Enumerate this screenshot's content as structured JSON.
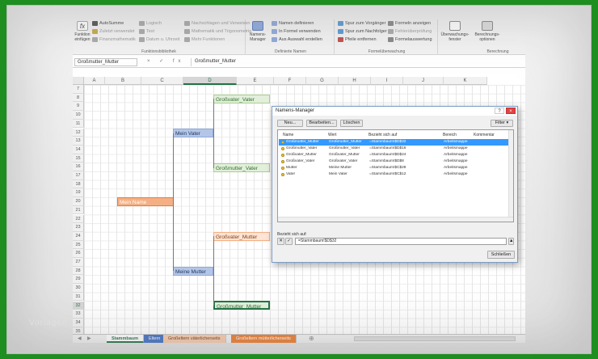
{
  "watermark": "Vorlagen",
  "ribbon": {
    "insert_function": "Funktion einfügen",
    "group1_items": [
      "AutoSumme",
      "Zuletzt verwendet",
      "Finanzmathematik"
    ],
    "group2_items": [
      "Logisch",
      "Text",
      "Datum u. Uhrzeit"
    ],
    "group3_items": [
      "Nachschlagen und Verweisen",
      "Mathematik und Trigonometrie",
      "Mehr Funktionen"
    ],
    "group_label_functions": "Funktionsbibliothek",
    "names_manager": "Namens-Manager",
    "names_items": [
      "Namen definieren",
      "In Formel verwenden",
      "Aus Auswahl erstellen"
    ],
    "group_label_names": "Definierte Namen",
    "audit_items_left": [
      "Spur zum Vorgänger",
      "Spur zum Nachfolger",
      "Pfeile entfernen"
    ],
    "audit_items_right": [
      "Formeln anzeigen",
      "Fehlerüberprüfung",
      "Formelauswertung"
    ],
    "group_label_audit": "Formelüberwachung",
    "watch_window": "Überwachungs-fenster",
    "calc_options": "Berechnungs-optionen",
    "group_label_calc": "Berechnung"
  },
  "formula_bar": {
    "name_box": "Großmutter_Mutter",
    "formula": "Großmutter_Mutter",
    "icons": "× ✓ fx"
  },
  "columns": [
    "A",
    "B",
    "C",
    "D",
    "E",
    "F",
    "G",
    "H",
    "I",
    "J",
    "K"
  ],
  "selected_column": "D",
  "rows": [
    "7",
    "8",
    "9",
    "10",
    "11",
    "12",
    "13",
    "14",
    "15",
    "16",
    "17",
    "18",
    "19",
    "20",
    "21",
    "22",
    "23",
    "24",
    "25",
    "26",
    "27",
    "28",
    "29",
    "30",
    "31",
    "32",
    "33",
    "34",
    "35"
  ],
  "selected_row": "32",
  "cells": {
    "grossvater_vater": "Großvater_Vater",
    "mein_vater": "Mein Vater",
    "grossmutter_vater": "Großmutter_Vater",
    "mein_name": "Mein Name",
    "grossvater_mutter": "Großvater_Mutter",
    "meine_mutter": "Meine Mutter",
    "grossmutter_mutter": "Großmutter_Mutter"
  },
  "sheet_tabs": [
    "Stammbaum",
    "Eltern",
    "Großeltern väterlicherseits",
    "Großeltern mütterlicherseits"
  ],
  "dialog": {
    "title": "Namens-Manager",
    "help": "?",
    "close": "×",
    "btn_new": "Neu...",
    "btn_edit": "Bearbeiten...",
    "btn_delete": "Löschen",
    "btn_filter": "Filter ▾",
    "headers": [
      "Name",
      "Wert",
      "Bezieht sich auf",
      "Bereich",
      "Kommentar"
    ],
    "rows": [
      {
        "name": "Großmutter_Mutter",
        "value": "Großmutter_Mutter",
        "refers": "=Stammbaum!$D$32",
        "scope": "Arbeitsmappe",
        "selected": true
      },
      {
        "name": "Großmutter_Vater",
        "value": "Großmutter_Vater",
        "refers": "=Stammbaum!$D$16",
        "scope": "Arbeitsmappe",
        "selected": false
      },
      {
        "name": "Großvater_Mutter",
        "value": "Großvater_Mutter",
        "refers": "=Stammbaum!$D$24",
        "scope": "Arbeitsmappe",
        "selected": false
      },
      {
        "name": "Großvater_Vater",
        "value": "Großvater_Vater",
        "refers": "=Stammbaum!$D$8",
        "scope": "Arbeitsmappe",
        "selected": false
      },
      {
        "name": "Mutter",
        "value": "Meine Mutter",
        "refers": "=Stammbaum!$C$28",
        "scope": "Arbeitsmappe",
        "selected": false
      },
      {
        "name": "Vater",
        "value": "Mein Vater",
        "refers": "=Stammbaum!$C$12",
        "scope": "Arbeitsmappe",
        "selected": false
      }
    ],
    "refers_label": "Bezieht sich auf:",
    "refers_value": "=Stammbaum!$D$32",
    "btn_close": "Schließen"
  }
}
